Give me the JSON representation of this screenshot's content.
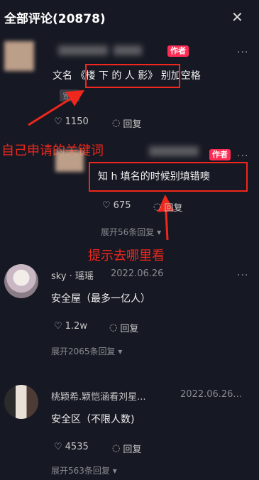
{
  "header": {
    "title": "全部评论(20878)",
    "close_glyph": "✕"
  },
  "comments": [
    {
      "author_tag": "作者",
      "text_prefix": "文名",
      "text_highlight": "《楼 下 的 人 影》",
      "text_suffix": "别加空格",
      "pinned_label": "置顶",
      "likes": "1150",
      "reply_label": "回复"
    },
    {
      "author_tag": "作者",
      "text": "知 h 填名的时候别填错噢",
      "likes": "675",
      "reply_label": "回复",
      "expand_label": "展开56条回复"
    },
    {
      "name": "sky · 瑶瑶",
      "date": "2022.06.26",
      "text": "安全屋（最多一亿人）",
      "likes": "1.2w",
      "reply_label": "回复",
      "expand_label": "展开2065条回复"
    },
    {
      "name": "桃颖希.颖恺涵看刘星...",
      "date": "2022.06.26...",
      "text": "安全区（不限人数)",
      "likes": "4535",
      "reply_label": "回复",
      "expand_label": "展开563条回复"
    }
  ],
  "annotations": {
    "note1": "自己申请的关键词",
    "note2": "提示去哪里看"
  },
  "colors": {
    "background": "#161823",
    "author_tag": "#fe2c55",
    "annotation": "#f0271c"
  }
}
